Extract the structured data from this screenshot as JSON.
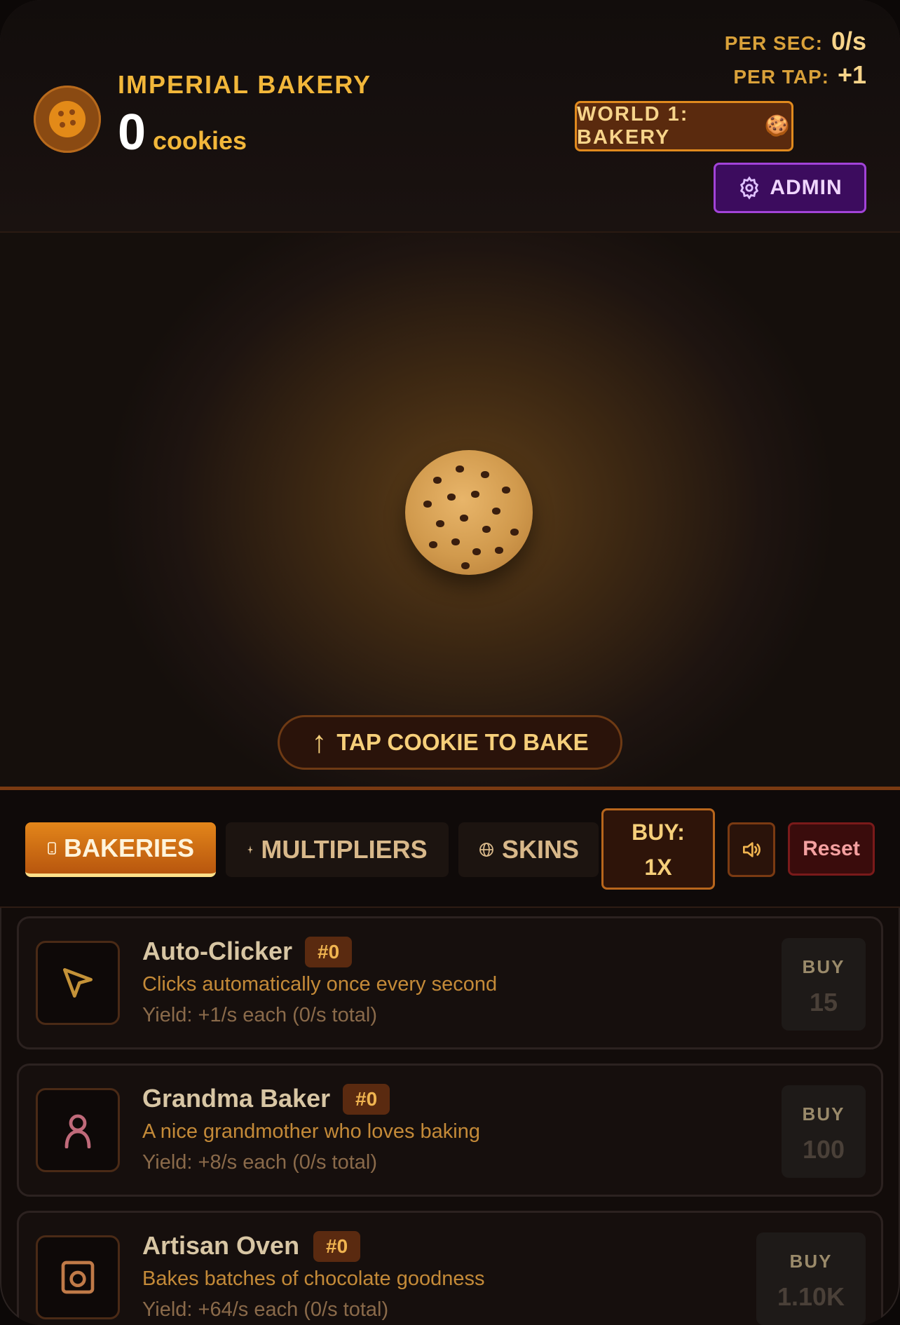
{
  "header": {
    "title": "IMPERIAL BAKERY",
    "cookie_count": "0",
    "cookie_unit": "cookies",
    "per_sec_label": "PER SEC:",
    "per_sec_value": "0/s",
    "per_tap_label": "PER TAP:",
    "per_tap_value": "+1",
    "world_label": "WORLD 1: BAKERY",
    "world_emoji": "🍪",
    "admin_label": "ADMIN"
  },
  "play": {
    "tap_hint": "TAP COOKIE TO BAKE",
    "tap_hint_icon": "↑"
  },
  "toolbar": {
    "tabs": [
      {
        "label": "BAKERIES",
        "icon": "phone-icon",
        "active": true
      },
      {
        "label": "MULTIPLIERS",
        "icon": "sparkle-icon",
        "active": false
      },
      {
        "label": "SKINS",
        "icon": "globe-icon",
        "active": false
      }
    ],
    "buy_line1": "BUY:",
    "buy_line2": "1X",
    "sound_icon": "speaker-icon",
    "reset_label": "Reset"
  },
  "items": [
    {
      "name": "Auto-Clicker",
      "badge": "#0",
      "desc": "Clicks automatically once every second",
      "yield": "Yield: +1/s each (0/s total)",
      "buy_label": "BUY",
      "price": "15",
      "icon": "cursor-icon"
    },
    {
      "name": "Grandma Baker",
      "badge": "#0",
      "desc": "A nice grandmother who loves baking",
      "yield": "Yield: +8/s each (0/s total)",
      "buy_label": "BUY",
      "price": "100",
      "icon": "person-icon"
    },
    {
      "name": "Artisan Oven",
      "badge": "#0",
      "desc": "Bakes batches of chocolate goodness",
      "yield": "Yield: +64/s each (0/s total)",
      "buy_label": "BUY",
      "price": "1.10K",
      "icon": "oven-icon"
    }
  ],
  "colors": {
    "accent": "#e3861a",
    "gold": "#f2b73a",
    "admin": "#a243d8",
    "reset": "#7a1a1a"
  }
}
